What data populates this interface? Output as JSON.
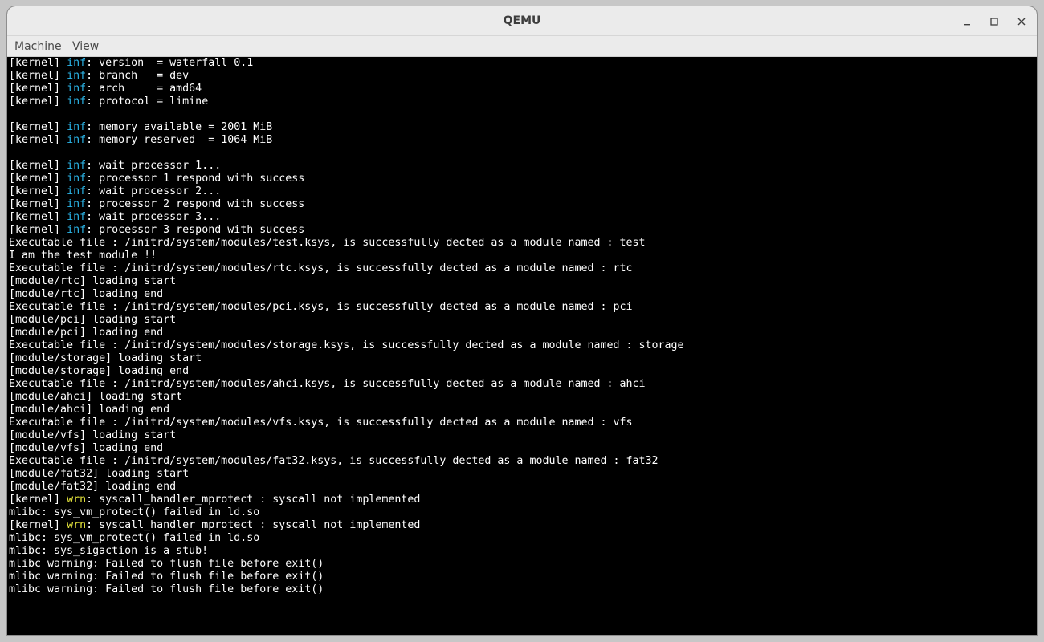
{
  "window": {
    "title": "QEMU",
    "controls": {
      "minimize": "minimize-icon",
      "maximize": "maximize-icon",
      "close": "close-icon"
    }
  },
  "menu": {
    "items": [
      "Machine",
      "View"
    ]
  },
  "colors": {
    "inf": "#2bb5e8",
    "wrn": "#e6e63c",
    "text": "#ffffff",
    "background": "#000000"
  },
  "console": {
    "lines": [
      {
        "prefix": "[kernel] ",
        "level": "inf",
        "rest": ": version  = waterfall 0.1"
      },
      {
        "prefix": "[kernel] ",
        "level": "inf",
        "rest": ": branch   = dev"
      },
      {
        "prefix": "[kernel] ",
        "level": "inf",
        "rest": ": arch     = amd64"
      },
      {
        "prefix": "[kernel] ",
        "level": "inf",
        "rest": ": protocol = limine"
      },
      {
        "text": ""
      },
      {
        "prefix": "[kernel] ",
        "level": "inf",
        "rest": ": memory available = 2001 MiB"
      },
      {
        "prefix": "[kernel] ",
        "level": "inf",
        "rest": ": memory reserved  = 1064 MiB"
      },
      {
        "text": ""
      },
      {
        "prefix": "[kernel] ",
        "level": "inf",
        "rest": ": wait processor 1..."
      },
      {
        "prefix": "[kernel] ",
        "level": "inf",
        "rest": ": processor 1 respond with success"
      },
      {
        "prefix": "[kernel] ",
        "level": "inf",
        "rest": ": wait processor 2..."
      },
      {
        "prefix": "[kernel] ",
        "level": "inf",
        "rest": ": processor 2 respond with success"
      },
      {
        "prefix": "[kernel] ",
        "level": "inf",
        "rest": ": wait processor 3..."
      },
      {
        "prefix": "[kernel] ",
        "level": "inf",
        "rest": ": processor 3 respond with success"
      },
      {
        "text": "Executable file : /initrd/system/modules/test.ksys, is successfully dected as a module named : test"
      },
      {
        "text": "I am the test module !!"
      },
      {
        "text": "Executable file : /initrd/system/modules/rtc.ksys, is successfully dected as a module named : rtc"
      },
      {
        "text": "[module/rtc] loading start"
      },
      {
        "text": "[module/rtc] loading end"
      },
      {
        "text": "Executable file : /initrd/system/modules/pci.ksys, is successfully dected as a module named : pci"
      },
      {
        "text": "[module/pci] loading start"
      },
      {
        "text": "[module/pci] loading end"
      },
      {
        "text": "Executable file : /initrd/system/modules/storage.ksys, is successfully dected as a module named : storage"
      },
      {
        "text": "[module/storage] loading start"
      },
      {
        "text": "[module/storage] loading end"
      },
      {
        "text": "Executable file : /initrd/system/modules/ahci.ksys, is successfully dected as a module named : ahci"
      },
      {
        "text": "[module/ahci] loading start"
      },
      {
        "text": "[module/ahci] loading end"
      },
      {
        "text": "Executable file : /initrd/system/modules/vfs.ksys, is successfully dected as a module named : vfs"
      },
      {
        "text": "[module/vfs] loading start"
      },
      {
        "text": "[module/vfs] loading end"
      },
      {
        "text": "Executable file : /initrd/system/modules/fat32.ksys, is successfully dected as a module named : fat32"
      },
      {
        "text": "[module/fat32] loading start"
      },
      {
        "text": "[module/fat32] loading end"
      },
      {
        "prefix": "[kernel] ",
        "level": "wrn",
        "rest": ": syscall_handler_mprotect : syscall not implemented"
      },
      {
        "text": "mlibc: sys_vm_protect() failed in ld.so"
      },
      {
        "prefix": "[kernel] ",
        "level": "wrn",
        "rest": ": syscall_handler_mprotect : syscall not implemented"
      },
      {
        "text": "mlibc: sys_vm_protect() failed in ld.so"
      },
      {
        "text": "mlibc: sys_sigaction is a stub!"
      },
      {
        "text": "mlibc warning: Failed to flush file before exit()"
      },
      {
        "text": "mlibc warning: Failed to flush file before exit()"
      },
      {
        "text": "mlibc warning: Failed to flush file before exit()"
      }
    ]
  }
}
